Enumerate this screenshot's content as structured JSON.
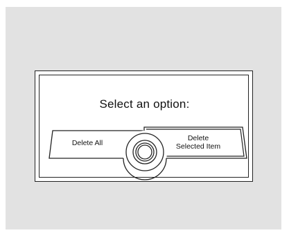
{
  "dialog": {
    "prompt": "Select an option:"
  },
  "options": {
    "delete_all": "Delete All",
    "delete_selected_line1": "Delete",
    "delete_selected_line2": "Selected Item",
    "selected": "Delete Selected Item"
  },
  "icons": {
    "knob": "interface-dial-icon"
  },
  "colors": {
    "background_panel": "#e2e2e2",
    "screen": "#ffffff",
    "outline": "#222222"
  }
}
